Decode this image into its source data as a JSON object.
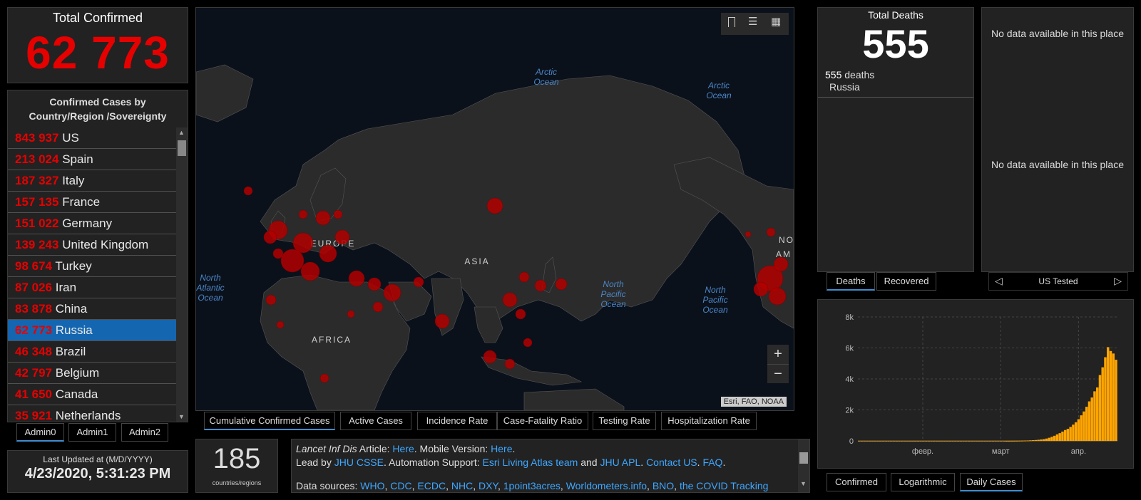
{
  "total_confirmed": {
    "label": "Total Confirmed",
    "value": "62 773"
  },
  "country_list": {
    "title": "Confirmed Cases by Country/Region /Sovereignty",
    "rows": [
      {
        "num": "843 937",
        "name": "US"
      },
      {
        "num": "213 024",
        "name": "Spain"
      },
      {
        "num": "187 327",
        "name": "Italy"
      },
      {
        "num": "157 135",
        "name": "France"
      },
      {
        "num": "151 022",
        "name": "Germany"
      },
      {
        "num": "139 243",
        "name": "United Kingdom"
      },
      {
        "num": "98 674",
        "name": "Turkey"
      },
      {
        "num": "87 026",
        "name": "Iran"
      },
      {
        "num": "83 878",
        "name": "China"
      },
      {
        "num": "62 773",
        "name": "Russia"
      },
      {
        "num": "46 348",
        "name": "Brazil"
      },
      {
        "num": "42 797",
        "name": "Belgium"
      },
      {
        "num": "41 650",
        "name": "Canada"
      },
      {
        "num": "35 921",
        "name": "Netherlands"
      }
    ],
    "selected": "Russia"
  },
  "admin_tabs": [
    "Admin0",
    "Admin1",
    "Admin2"
  ],
  "last_updated": {
    "label": "Last Updated at (M/D/YYYY)",
    "value": "4/23/2020, 5:31:23 PM"
  },
  "map": {
    "labels": {
      "arctic1": [
        "Arctic",
        "Ocean"
      ],
      "arctic2": [
        "Arctic",
        "Ocean"
      ],
      "natl": [
        "North",
        "Atlantic",
        "Ocean"
      ],
      "npac1": [
        "North",
        "Pacific",
        "Ocean"
      ],
      "npac2": [
        "North",
        "Pacific",
        "Ocean"
      ],
      "europe": "EUROPE",
      "asia": "ASIA",
      "africa": "AFRICA",
      "na_cut1": "NO",
      "na_cut2": "AM"
    },
    "attribution": "Esri, FAO, NOAA",
    "zoom_in": "+",
    "zoom_out": "−",
    "tabs": [
      "Cumulative Confirmed Cases",
      "Active Cases",
      "Incidence Rate",
      "Case-Fatality Ratio",
      "Testing Rate",
      "Hospitalization Rate"
    ]
  },
  "countries_count": {
    "value": "185",
    "label": "countries/regions"
  },
  "info": {
    "line1": {
      "italic": "Lancet Inf Dis",
      "t1": " Article: ",
      "l1": "Here",
      "t2": ". Mobile Version: ",
      "l2": "Here",
      "t3": "."
    },
    "line2": {
      "t1": "Lead by ",
      "l1": "JHU CSSE",
      "t2": ". Automation Support: ",
      "l2": "Esri Living Atlas team",
      "t3": " and ",
      "l3": "JHU APL",
      "t4": ". ",
      "l4": "Contact US",
      "t5": ". ",
      "l5": "FAQ",
      "t6": "."
    },
    "line3": {
      "t1": "Data sources: ",
      "links": [
        "WHO",
        "CDC",
        "ECDC",
        "NHC",
        "DXY",
        "1point3acres",
        "Worldometers.info",
        "BNO",
        "the COVID Tracking"
      ]
    }
  },
  "total_deaths": {
    "label": "Total Deaths",
    "value": "555",
    "detail_num": "555",
    "detail_unit": "deaths",
    "detail_place": "Russia"
  },
  "deaths_tabs": [
    "Deaths",
    "Recovered"
  ],
  "right_panel": {
    "msg1": "No data available in this place",
    "msg2": "No data available in this place",
    "nav_label": "US Tested"
  },
  "chart_tabs": [
    "Confirmed",
    "Logarithmic",
    "Daily Cases"
  ],
  "chart_data": {
    "type": "bar",
    "title": "",
    "xlabel": "",
    "ylabel": "",
    "ylim": [
      0,
      8000
    ],
    "yticks": [
      "0",
      "2k",
      "4k",
      "6k",
      "8k"
    ],
    "xticks": [
      "февр.",
      "март",
      "апр."
    ],
    "grid": true,
    "color": "#ffa500",
    "values": [
      0,
      0,
      0,
      0,
      0,
      0,
      0,
      0,
      0,
      0,
      0,
      0,
      0,
      0,
      0,
      0,
      0,
      0,
      0,
      0,
      0,
      0,
      0,
      0,
      0,
      0,
      0,
      0,
      0,
      0,
      0,
      0,
      0,
      0,
      0,
      0,
      0,
      0,
      0,
      0,
      0,
      0,
      0,
      0,
      0,
      0,
      0,
      0,
      0,
      0,
      0,
      0,
      0,
      0,
      0,
      2,
      3,
      5,
      6,
      8,
      12,
      15,
      20,
      25,
      35,
      45,
      55,
      70,
      90,
      110,
      150,
      200,
      260,
      330,
      420,
      500,
      600,
      700,
      780,
      900,
      1050,
      1200,
      1400,
      1650,
      1900,
      2200,
      2550,
      2800,
      3200,
      3450,
      4250,
      4750,
      5400,
      6050,
      5800,
      5640,
      5240
    ]
  },
  "colors": {
    "accent": "#3e8ed0",
    "confirmed": "#e60000",
    "selected_row": "#1466b0",
    "bar": "#ffa500",
    "link": "#3ea7ff"
  }
}
